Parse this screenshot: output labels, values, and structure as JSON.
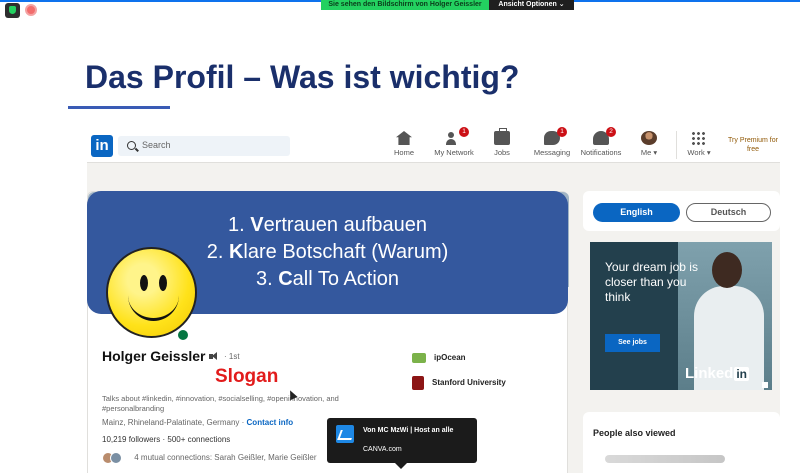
{
  "zoom": {
    "share_banner": "Sie sehen den Bildschirm von Holger Geissler",
    "view_options": "Ansicht Optionen ⌄"
  },
  "slide": {
    "title": "Das Profil – Was ist wichtig?",
    "points": [
      {
        "first": "V",
        "rest": "ertrauen aufbauen",
        "num": "1."
      },
      {
        "first": "K",
        "rest": "lare Botschaft (Warum)",
        "num": "2."
      },
      {
        "first": "C",
        "rest": "all To Action",
        "num": "3."
      }
    ],
    "slogan": "Slogan"
  },
  "linkedin": {
    "logo": "in",
    "search_placeholder": "Search",
    "nav": [
      {
        "label": "Home",
        "icon": "home-icon",
        "badge": ""
      },
      {
        "label": "My Network",
        "icon": "network-icon",
        "badge": "1"
      },
      {
        "label": "Jobs",
        "icon": "jobs-icon",
        "badge": ""
      },
      {
        "label": "Messaging",
        "icon": "messaging-icon",
        "badge": "1"
      },
      {
        "label": "Notifications",
        "icon": "notifications-icon",
        "badge": "2"
      },
      {
        "label": "Me ▾",
        "icon": "avatar-icon",
        "badge": ""
      },
      {
        "label": "Work ▾",
        "icon": "grid-icon",
        "badge": ""
      }
    ],
    "premium": "Try Premium for free",
    "profile": {
      "name": "Holger Geissler",
      "degree": "· 1st",
      "headline": "Talks about #linkedin, #innovation, #socialselling, #openinnovation, and #personalbranding",
      "location": "Mainz, Rhineland-Palatinate, Germany ·",
      "contact": "Contact info",
      "stats": "10,219 followers · 500+ connections",
      "mutual": "4 mutual connections: Sarah Geißler, Marie Geißler",
      "companies": [
        "ipOcean",
        "Stanford University"
      ]
    },
    "languages": {
      "active": "English",
      "other": "Deutsch"
    },
    "ad": {
      "text": "Your dream job is closer than you think",
      "button": "See jobs",
      "brand": "Linked",
      "brand_in": "in"
    },
    "people_also_viewed": "People also viewed"
  },
  "host_popup": {
    "name": "Von MC MzWi | Host an alle",
    "sub": "CANVA.com"
  }
}
